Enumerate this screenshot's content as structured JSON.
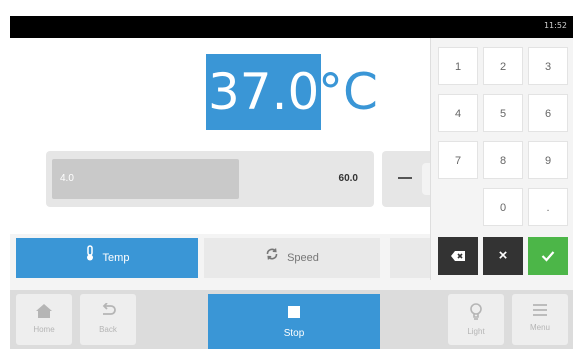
{
  "status_bar": {
    "time": "11:52"
  },
  "setpoint": {
    "value": "37.0",
    "unit": "°C"
  },
  "range": {
    "min": "4.0",
    "max": "60.0"
  },
  "tabs": [
    {
      "label": "Temp",
      "icon": "thermometer-icon",
      "active": true
    },
    {
      "label": "Speed",
      "icon": "rotate-icon",
      "active": false
    }
  ],
  "keypad": {
    "keys": [
      "1",
      "2",
      "3",
      "4",
      "5",
      "6",
      "7",
      "8",
      "9",
      "0",
      "."
    ],
    "backspace_icon": "backspace-icon",
    "cancel_label": "×",
    "confirm_icon": "check-icon"
  },
  "bottom_nav": {
    "home": "Home",
    "back": "Back",
    "stop": "Stop",
    "light": "Light",
    "menu": "Menu"
  },
  "colors": {
    "accent": "#3a96d6",
    "confirm": "#4cb648",
    "dark_key": "#333333"
  }
}
